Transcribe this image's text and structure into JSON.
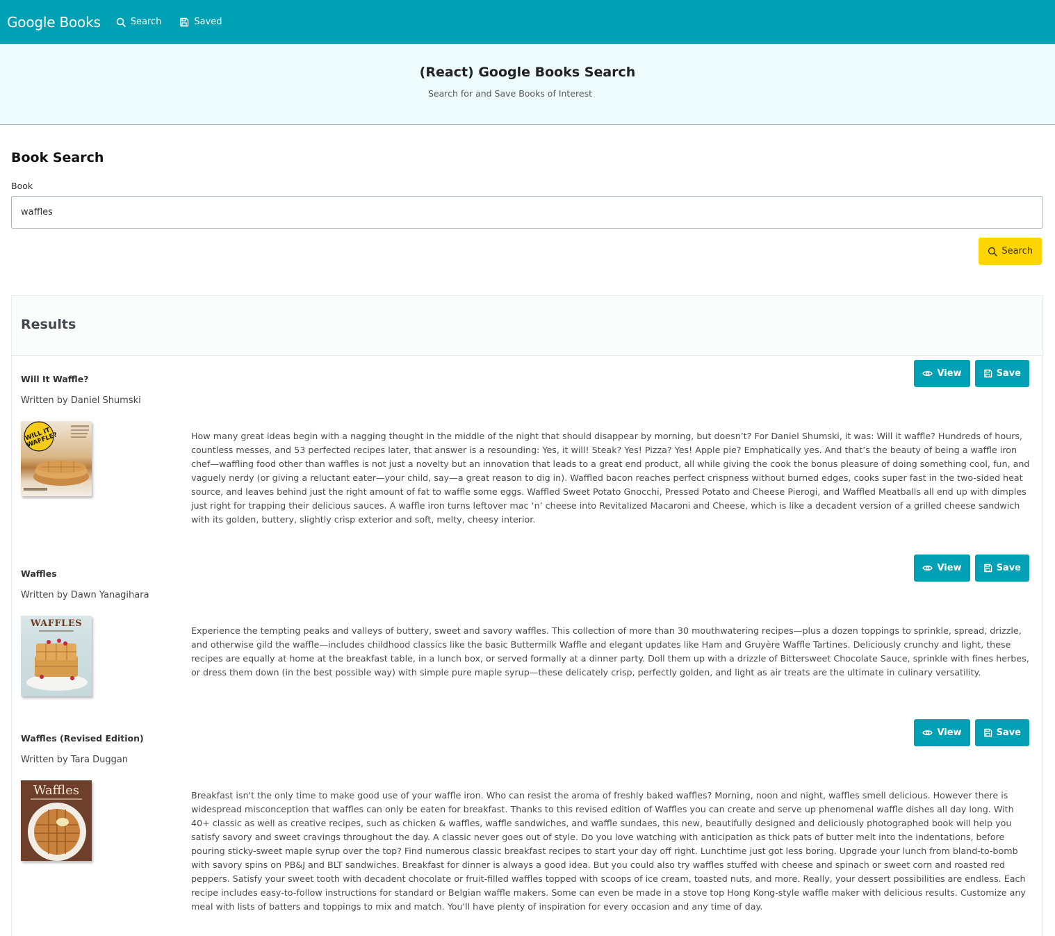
{
  "navbar": {
    "brand": "Google Books",
    "links": [
      {
        "label": "Search",
        "icon": "search-icon"
      },
      {
        "label": "Saved",
        "icon": "save-icon"
      }
    ]
  },
  "hero": {
    "title": "(React) Google Books Search",
    "subtitle": "Search for and Save Books of Interest"
  },
  "search": {
    "heading": "Book Search",
    "field_label": "Book",
    "value": "waffles",
    "button_label": "Search"
  },
  "results": {
    "heading": "Results",
    "view_label": "View",
    "save_label": "Save",
    "books": [
      {
        "title": "Will It Waffle?",
        "author": "Written by Daniel Shumski",
        "cover_text": "WILL IT WAFFLE?",
        "description": "How many great ideas begin with a nagging thought in the middle of the night that should disappear by morning, but doesn’t? For Daniel Shumski, it was: Will it waffle? Hundreds of hours, countless messes, and 53 perfected recipes later, that answer is a resounding: Yes, it will! Steak? Yes! Pizza? Yes! Apple pie? Emphatically yes. And that’s the beauty of being a waffle iron chef—waffling food other than waffles is not just a novelty but an innovation that leads to a great end product, all while giving the cook the bonus pleasure of doing something cool, fun, and vaguely nerdy (or giving a reluctant eater—your child, say—a great reason to dig in). Waffled bacon reaches perfect crispness without burned edges, cooks super fast in the two-sided heat source, and leaves behind just the right amount of fat to waffle some eggs. Waffled Sweet Potato Gnocchi, Pressed Potato and Cheese Pierogi, and Waffled Meatballs all end up with dimples just right for trapping their delicious sauces. A waffle iron turns leftover mac ‘n’ cheese into Revitalized Macaroni and Cheese, which is like a decadent version of a grilled cheese sandwich with its golden, buttery, slightly crisp exterior and soft, melty, cheesy interior."
      },
      {
        "title": "Waffles",
        "author": "Written by Dawn Yanagihara",
        "cover_text": "WAFFLES",
        "description": "Experience the tempting peaks and valleys of buttery, sweet and savory waffles. This collection of more than 30 mouthwatering recipes—plus a dozen toppings to sprinkle, spread, drizzle, and otherwise gild the waffle—includes childhood classics like the basic Buttermilk Waffle and elegant updates like Ham and Gruyère Waffle Tartines. Deliciously crunchy and light, these recipes are equally at home at the breakfast table, in a lunch box, or served formally at a dinner party. Doll them up with a drizzle of Bittersweet Chocolate Sauce, sprinkle with fines herbes, or dress them down (in the best possible way) with simple pure maple syrup—these delicately crisp, perfectly golden, and light as air treats are the ultimate in culinary versatility."
      },
      {
        "title": "Waffles (Revised Edition)",
        "author": "Written by Tara Duggan",
        "cover_text": "Waffles",
        "description": "Breakfast isn't the only time to make good use of your waffle iron. Who can resist the aroma of freshly baked waffles? Morning, noon and night, waffles smell delicious. However there is widespread misconception that waffles can only be eaten for breakfast. Thanks to this revised edition of Waffles you can create and serve up phenomenal waffle dishes all day long. With 40+ classic as well as creative recipes, such as chicken & waffles, waffle sandwiches, and waffle sundaes, this new, beautifully designed and deliciously photographed book will help you satisfy savory and sweet cravings throughout the day. A classic never goes out of style. Do you love watching with anticipation as thick pats of butter melt into the indentations, before pouring sticky-sweet maple syrup over the top? Find numerous classic breakfast recipes to start your day off right. Lunchtime just got less boring. Upgrade your lunch from bland-to-bomb with savory spins on PB&J and BLT sandwiches. Breakfast for dinner is always a good idea. But you could also try waffles stuffed with cheese and spinach or sweet corn and roasted red peppers. Satisfy your sweet tooth with decadent chocolate or fruit-filled waffles topped with scoops of ice cream, toasted nuts, and more. Really, your dessert possibilities are endless. Each recipe includes easy-to-follow instructions for standard or Belgian waffle makers. Some can even be made in a stove top Hong Kong-style waffle maker with delicious results. Customize any meal with lists of batters and toppings to mix and match. You'll have plenty of inspiration for every occasion and any time of day."
      }
    ]
  },
  "colors": {
    "navbar": "#00a0b5",
    "hero_bg": "#effcfe",
    "search_button": "#ffd500",
    "action_button": "#00a0b5"
  }
}
